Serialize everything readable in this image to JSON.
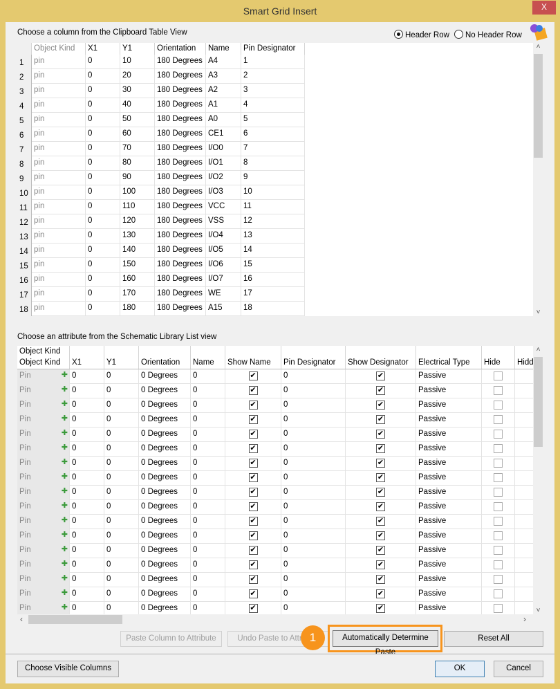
{
  "window": {
    "title": "Smart Grid Insert",
    "close_label": "X"
  },
  "top": {
    "label": "Choose a column from the Clipboard Table View",
    "header_row": "Header Row",
    "no_header_row": "No Header Row",
    "header_row_selected": true,
    "columns": [
      "Object Kind",
      "X1",
      "Y1",
      "Orientation",
      "Name",
      "Pin Designator"
    ],
    "rows": [
      [
        "1",
        "pin",
        "0",
        "10",
        "180 Degrees",
        "A4",
        "1"
      ],
      [
        "2",
        "pin",
        "0",
        "20",
        "180 Degrees",
        "A3",
        "2"
      ],
      [
        "3",
        "pin",
        "0",
        "30",
        "180 Degrees",
        "A2",
        "3"
      ],
      [
        "4",
        "pin",
        "0",
        "40",
        "180 Degrees",
        "A1",
        "4"
      ],
      [
        "5",
        "pin",
        "0",
        "50",
        "180 Degrees",
        "A0",
        "5"
      ],
      [
        "6",
        "pin",
        "0",
        "60",
        "180 Degrees",
        "CE1",
        "6"
      ],
      [
        "7",
        "pin",
        "0",
        "70",
        "180 Degrees",
        "I/O0",
        "7"
      ],
      [
        "8",
        "pin",
        "0",
        "80",
        "180 Degrees",
        "I/O1",
        "8"
      ],
      [
        "9",
        "pin",
        "0",
        "90",
        "180 Degrees",
        "I/O2",
        "9"
      ],
      [
        "10",
        "pin",
        "0",
        "100",
        "180 Degrees",
        "I/O3",
        "10"
      ],
      [
        "11",
        "pin",
        "0",
        "110",
        "180 Degrees",
        "VCC",
        "11"
      ],
      [
        "12",
        "pin",
        "0",
        "120",
        "180 Degrees",
        "VSS",
        "12"
      ],
      [
        "13",
        "pin",
        "0",
        "130",
        "180 Degrees",
        "I/O4",
        "13"
      ],
      [
        "14",
        "pin",
        "0",
        "140",
        "180 Degrees",
        "I/O5",
        "14"
      ],
      [
        "15",
        "pin",
        "0",
        "150",
        "180 Degrees",
        "I/O6",
        "15"
      ],
      [
        "16",
        "pin",
        "0",
        "160",
        "180 Degrees",
        "I/O7",
        "16"
      ],
      [
        "17",
        "pin",
        "0",
        "170",
        "180 Degrees",
        "WE",
        "17"
      ],
      [
        "18",
        "pin",
        "0",
        "180",
        "180 Degrees",
        "A15",
        "18"
      ]
    ]
  },
  "bottom": {
    "label": "Choose an attribute from the Schematic Library List view",
    "group_header": "Object Kind",
    "columns": [
      "Object Kind",
      "X1",
      "Y1",
      "Orientation",
      "Name",
      "Show Name",
      "Pin Designator",
      "Show Designator",
      "Electrical Type",
      "Hide",
      "Hidd"
    ],
    "row_template": {
      "kind": "Pin",
      "x1": "0",
      "y1": "0",
      "orientation": "0 Degrees",
      "name": "0",
      "show_name": true,
      "pin_designator": "0",
      "show_designator": true,
      "electrical_type": "Passive",
      "hide": false
    },
    "row_count_visible": 17
  },
  "buttons": {
    "paste": "Paste Column to Attribute",
    "undo": "Undo Paste to Attribute",
    "auto": "Automatically Determine Paste",
    "reset": "Reset All",
    "choose": "Choose Visible Columns",
    "ok": "OK",
    "cancel": "Cancel"
  },
  "annotation": {
    "badge": "1",
    "color": "#f7941d"
  }
}
